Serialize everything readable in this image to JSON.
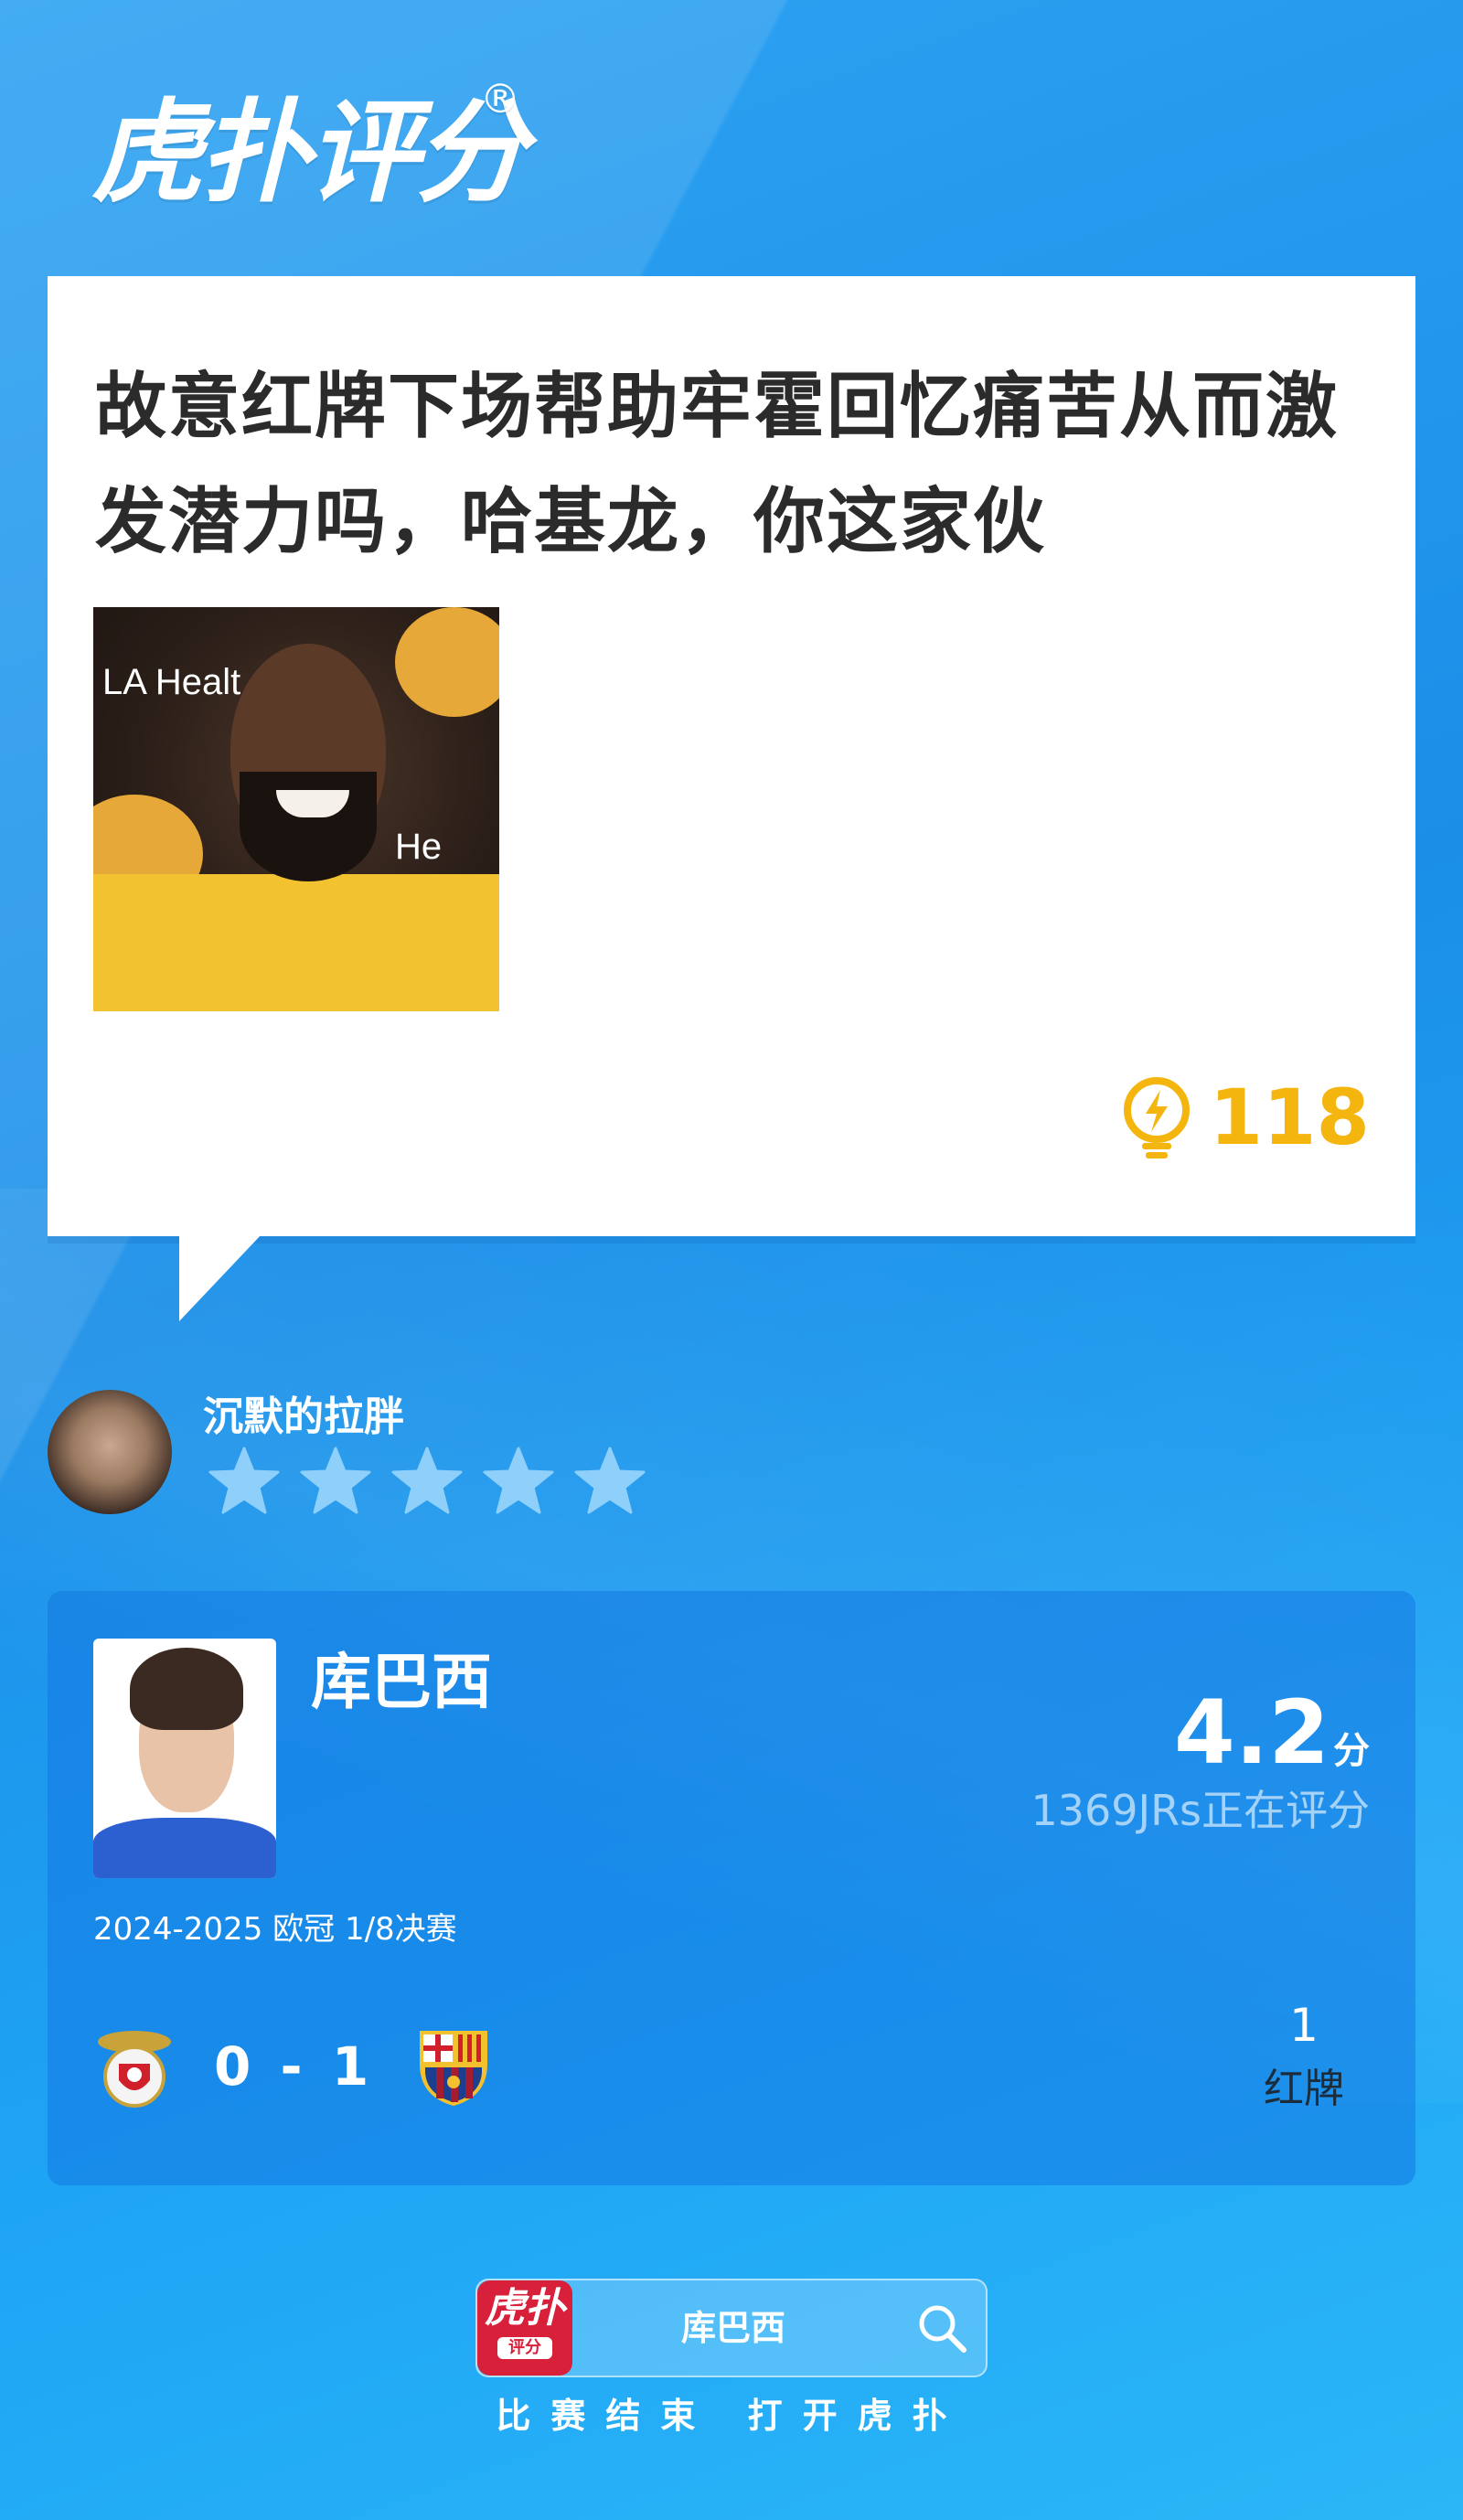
{
  "brand": {
    "name": "虎扑评分",
    "registered": "®",
    "mini_name": "虎扑",
    "mini_sub": "评分"
  },
  "comment": {
    "text": "故意红牌下场帮助牢霍回忆痛苦从而激发潜力吗，哈基龙，你这家伙",
    "image_signs": [
      "LA Healt",
      "He"
    ],
    "likes": "118",
    "icon": "lightbulb-icon",
    "accent_color": "#f5b50f"
  },
  "user": {
    "name": "沉默的拉胖",
    "stars_total": 5,
    "stars_filled": 0,
    "icons": [
      "avatar",
      "star-icon"
    ]
  },
  "rating": {
    "player_name": "库巴西",
    "score": "4.2",
    "score_unit": "分",
    "raters": "1369JRs正在评分",
    "match_info": "2024-2025 欧冠 1/8决赛",
    "home_logo": "benfica-logo-icon",
    "away_logo": "barcelona-logo-icon",
    "match_score": "0 - 1",
    "event_count": "1",
    "event_label": "红牌"
  },
  "bottom": {
    "query": "库巴西",
    "caption": "比赛结束 打开虎扑",
    "icon": "search-icon"
  }
}
